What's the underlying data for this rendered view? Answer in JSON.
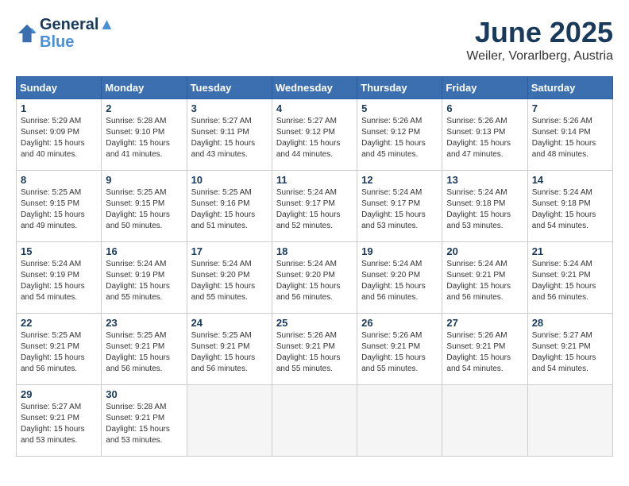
{
  "header": {
    "logo_line1": "General",
    "logo_line2": "Blue",
    "month": "June 2025",
    "location": "Weiler, Vorarlberg, Austria"
  },
  "weekdays": [
    "Sunday",
    "Monday",
    "Tuesday",
    "Wednesday",
    "Thursday",
    "Friday",
    "Saturday"
  ],
  "weeks": [
    [
      {
        "day": "1",
        "info": "Sunrise: 5:29 AM\nSunset: 9:09 PM\nDaylight: 15 hours\nand 40 minutes."
      },
      {
        "day": "2",
        "info": "Sunrise: 5:28 AM\nSunset: 9:10 PM\nDaylight: 15 hours\nand 41 minutes."
      },
      {
        "day": "3",
        "info": "Sunrise: 5:27 AM\nSunset: 9:11 PM\nDaylight: 15 hours\nand 43 minutes."
      },
      {
        "day": "4",
        "info": "Sunrise: 5:27 AM\nSunset: 9:12 PM\nDaylight: 15 hours\nand 44 minutes."
      },
      {
        "day": "5",
        "info": "Sunrise: 5:26 AM\nSunset: 9:12 PM\nDaylight: 15 hours\nand 45 minutes."
      },
      {
        "day": "6",
        "info": "Sunrise: 5:26 AM\nSunset: 9:13 PM\nDaylight: 15 hours\nand 47 minutes."
      },
      {
        "day": "7",
        "info": "Sunrise: 5:26 AM\nSunset: 9:14 PM\nDaylight: 15 hours\nand 48 minutes."
      }
    ],
    [
      {
        "day": "8",
        "info": "Sunrise: 5:25 AM\nSunset: 9:15 PM\nDaylight: 15 hours\nand 49 minutes."
      },
      {
        "day": "9",
        "info": "Sunrise: 5:25 AM\nSunset: 9:15 PM\nDaylight: 15 hours\nand 50 minutes."
      },
      {
        "day": "10",
        "info": "Sunrise: 5:25 AM\nSunset: 9:16 PM\nDaylight: 15 hours\nand 51 minutes."
      },
      {
        "day": "11",
        "info": "Sunrise: 5:24 AM\nSunset: 9:17 PM\nDaylight: 15 hours\nand 52 minutes."
      },
      {
        "day": "12",
        "info": "Sunrise: 5:24 AM\nSunset: 9:17 PM\nDaylight: 15 hours\nand 53 minutes."
      },
      {
        "day": "13",
        "info": "Sunrise: 5:24 AM\nSunset: 9:18 PM\nDaylight: 15 hours\nand 53 minutes."
      },
      {
        "day": "14",
        "info": "Sunrise: 5:24 AM\nSunset: 9:18 PM\nDaylight: 15 hours\nand 54 minutes."
      }
    ],
    [
      {
        "day": "15",
        "info": "Sunrise: 5:24 AM\nSunset: 9:19 PM\nDaylight: 15 hours\nand 54 minutes."
      },
      {
        "day": "16",
        "info": "Sunrise: 5:24 AM\nSunset: 9:19 PM\nDaylight: 15 hours\nand 55 minutes."
      },
      {
        "day": "17",
        "info": "Sunrise: 5:24 AM\nSunset: 9:20 PM\nDaylight: 15 hours\nand 55 minutes."
      },
      {
        "day": "18",
        "info": "Sunrise: 5:24 AM\nSunset: 9:20 PM\nDaylight: 15 hours\nand 56 minutes."
      },
      {
        "day": "19",
        "info": "Sunrise: 5:24 AM\nSunset: 9:20 PM\nDaylight: 15 hours\nand 56 minutes."
      },
      {
        "day": "20",
        "info": "Sunrise: 5:24 AM\nSunset: 9:21 PM\nDaylight: 15 hours\nand 56 minutes."
      },
      {
        "day": "21",
        "info": "Sunrise: 5:24 AM\nSunset: 9:21 PM\nDaylight: 15 hours\nand 56 minutes."
      }
    ],
    [
      {
        "day": "22",
        "info": "Sunrise: 5:25 AM\nSunset: 9:21 PM\nDaylight: 15 hours\nand 56 minutes."
      },
      {
        "day": "23",
        "info": "Sunrise: 5:25 AM\nSunset: 9:21 PM\nDaylight: 15 hours\nand 56 minutes."
      },
      {
        "day": "24",
        "info": "Sunrise: 5:25 AM\nSunset: 9:21 PM\nDaylight: 15 hours\nand 56 minutes."
      },
      {
        "day": "25",
        "info": "Sunrise: 5:26 AM\nSunset: 9:21 PM\nDaylight: 15 hours\nand 55 minutes."
      },
      {
        "day": "26",
        "info": "Sunrise: 5:26 AM\nSunset: 9:21 PM\nDaylight: 15 hours\nand 55 minutes."
      },
      {
        "day": "27",
        "info": "Sunrise: 5:26 AM\nSunset: 9:21 PM\nDaylight: 15 hours\nand 54 minutes."
      },
      {
        "day": "28",
        "info": "Sunrise: 5:27 AM\nSunset: 9:21 PM\nDaylight: 15 hours\nand 54 minutes."
      }
    ],
    [
      {
        "day": "29",
        "info": "Sunrise: 5:27 AM\nSunset: 9:21 PM\nDaylight: 15 hours\nand 53 minutes."
      },
      {
        "day": "30",
        "info": "Sunrise: 5:28 AM\nSunset: 9:21 PM\nDaylight: 15 hours\nand 53 minutes."
      },
      {
        "day": "",
        "info": ""
      },
      {
        "day": "",
        "info": ""
      },
      {
        "day": "",
        "info": ""
      },
      {
        "day": "",
        "info": ""
      },
      {
        "day": "",
        "info": ""
      }
    ]
  ]
}
